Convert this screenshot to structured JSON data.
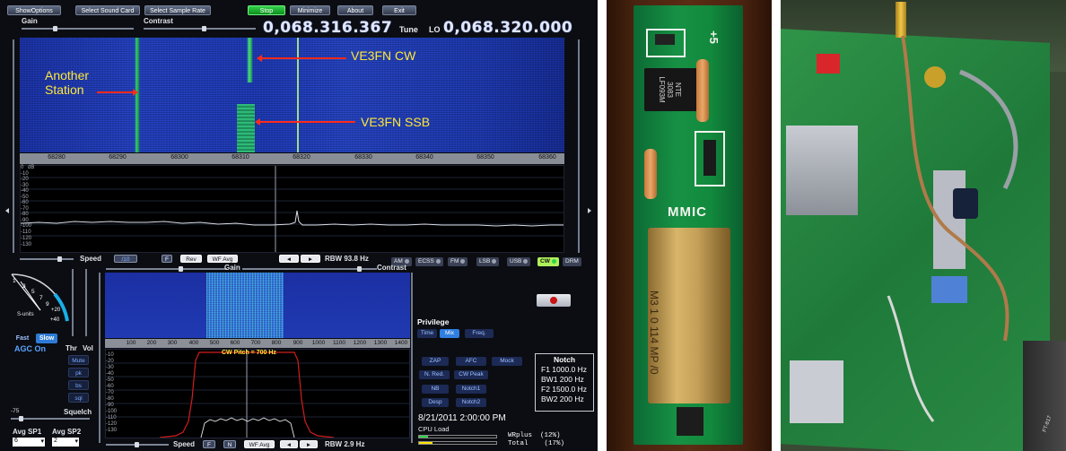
{
  "sdr": {
    "buttons": {
      "show_options": "ShowOptions",
      "select_sound_card": "Select Sound Card",
      "select_sample_rate": "Select Sample Rate",
      "stop": "Stop",
      "minimize": "Minimize",
      "about": "About",
      "exit": "Exit"
    },
    "labels": {
      "gain": "Gain",
      "contrast": "Contrast",
      "tune": "Tune",
      "lo": "LO"
    },
    "tune_freq": "0,068.316.367",
    "lo_freq": "0,068.320.000",
    "waterfall_axis": [
      "68280",
      "68290",
      "68300",
      "68310",
      "68320",
      "68330",
      "68340",
      "68350",
      "68360"
    ],
    "annotations": {
      "another_station": "Another\nStation",
      "ve3fn_cw": "VE3FN CW",
      "ve3fn_ssb": "VE3FN SSB"
    },
    "spectrum_ylabels": [
      "0",
      "dB",
      "-10",
      "-20",
      "-30",
      "-40",
      "-50",
      "-60",
      "-70",
      "-80",
      "-90",
      "-100",
      "-110",
      "-120",
      "-130"
    ],
    "speed": {
      "label": "Speed",
      "value": "/10",
      "f_btn": "F",
      "rev_btn": "Rev",
      "wfavg_btn": "WF Avg",
      "left": "◄",
      "right": "►",
      "rbw": "RBW 93.8 Hz"
    },
    "modes": [
      {
        "label": "AM",
        "on": false
      },
      {
        "label": "ECSS",
        "on": false
      },
      {
        "label": "FM",
        "on": false
      },
      {
        "label": "LSB",
        "on": false
      },
      {
        "label": "USB",
        "on": false
      },
      {
        "label": "CW",
        "on": true
      },
      {
        "label": "DRM",
        "on": false
      }
    ],
    "meter": {
      "scale": [
        "1",
        "3",
        "5",
        "7",
        "9",
        "+20",
        "+40"
      ],
      "label": "S-units"
    },
    "agc": {
      "fast": "Fast",
      "slow": "Slow",
      "status": "AGC On"
    },
    "thr": "Thr",
    "vol": "Vol",
    "side_buttons": [
      "Mute",
      "pk",
      "bs",
      "sql"
    ],
    "squelch": "Squelch",
    "squelch_value": "-75",
    "avg_sp1": {
      "label": "Avg SP1",
      "value": "6"
    },
    "avg_sp2": {
      "label": "Avg SP2",
      "value": "2"
    },
    "sub_gain": "Gain",
    "sub_contrast": "Contrast",
    "sub_axis": [
      "100",
      "200",
      "300",
      "400",
      "500",
      "600",
      "700",
      "800",
      "900",
      "1000",
      "1100",
      "1200",
      "1300",
      "1400"
    ],
    "cw_pitch": "CW Pitch = 700 Hz",
    "sub_ylabels": [
      "-10",
      "-20",
      "-30",
      "-40",
      "-50",
      "-60",
      "-70",
      "-80",
      "-90",
      "-100",
      "-110",
      "-120",
      "-130"
    ],
    "bottom": {
      "speed": "Speed",
      "f": "F",
      "n": "N",
      "wfavg": "WF Avg",
      "left": "◄",
      "right": "►",
      "rbw": "RBW  2.9 Hz"
    },
    "privilege": "Privilege",
    "priv_buttons": [
      {
        "label": "Time",
        "on": false
      },
      {
        "label": "Mix",
        "on": true
      },
      {
        "label": "Freq.",
        "on": false
      }
    ],
    "dsp_buttons": [
      "ZAP",
      "AFC",
      "Mock",
      "N. Red.",
      "CW Peak",
      "NB",
      "Notch1",
      "Desp",
      "Notch2"
    ],
    "notch": {
      "title": "Notch",
      "f1": "F1 1000.0 Hz",
      "bw1": "BW1  200 Hz",
      "f2": "F2 1500.0 Hz",
      "bw2": "BW2  200 Hz"
    },
    "datetime": "8/21/2011 2:00:00 PM",
    "cpu_load": "CPU Load",
    "wrplus": "WRplus  (12%)",
    "total": "Total    (17%)"
  },
  "photo1": {
    "pcb_label": "MMIC",
    "chip_text": [
      "NTE",
      "3083",
      "LF093M"
    ],
    "can_text": "M3 1 0 114 MP /0",
    "plus5": "+5"
  },
  "photo2": {
    "label": "FT-817"
  },
  "colors": {
    "waterfall_blue": "#2342c2",
    "signal_green": "#35d16a",
    "annotation_yellow": "#ffe83a",
    "arrow_red": "#ff2b1c",
    "pcb_green": "#179144"
  }
}
